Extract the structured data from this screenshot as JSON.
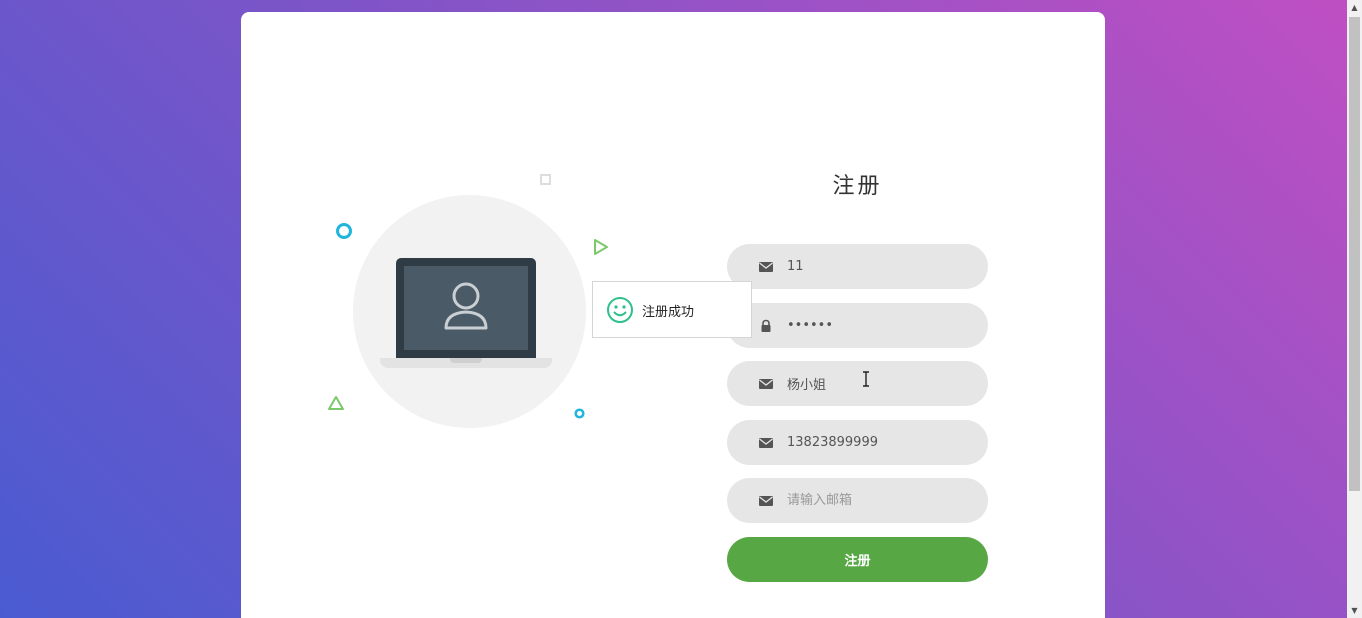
{
  "form": {
    "title": "注册",
    "fields": [
      {
        "name": "username",
        "icon": "envelope-icon",
        "value": "11",
        "placeholder": ""
      },
      {
        "name": "password",
        "icon": "lock-icon",
        "value": "••••••",
        "placeholder": ""
      },
      {
        "name": "realname",
        "icon": "envelope-icon",
        "value": "杨小姐",
        "placeholder": ""
      },
      {
        "name": "phone",
        "icon": "envelope-icon",
        "value": "13823899999",
        "placeholder": ""
      },
      {
        "name": "email",
        "icon": "envelope-icon",
        "value": "",
        "placeholder": "请输入邮箱"
      }
    ],
    "submit_label": "注册"
  },
  "toast": {
    "message": "注册成功",
    "icon": "smile-icon"
  },
  "colors": {
    "accent": "#57a845",
    "field_bg": "#e6e6e6",
    "cyan_deco": "#1fb5dc",
    "green_deco": "#7cc96c",
    "success": "#2fc08b"
  }
}
